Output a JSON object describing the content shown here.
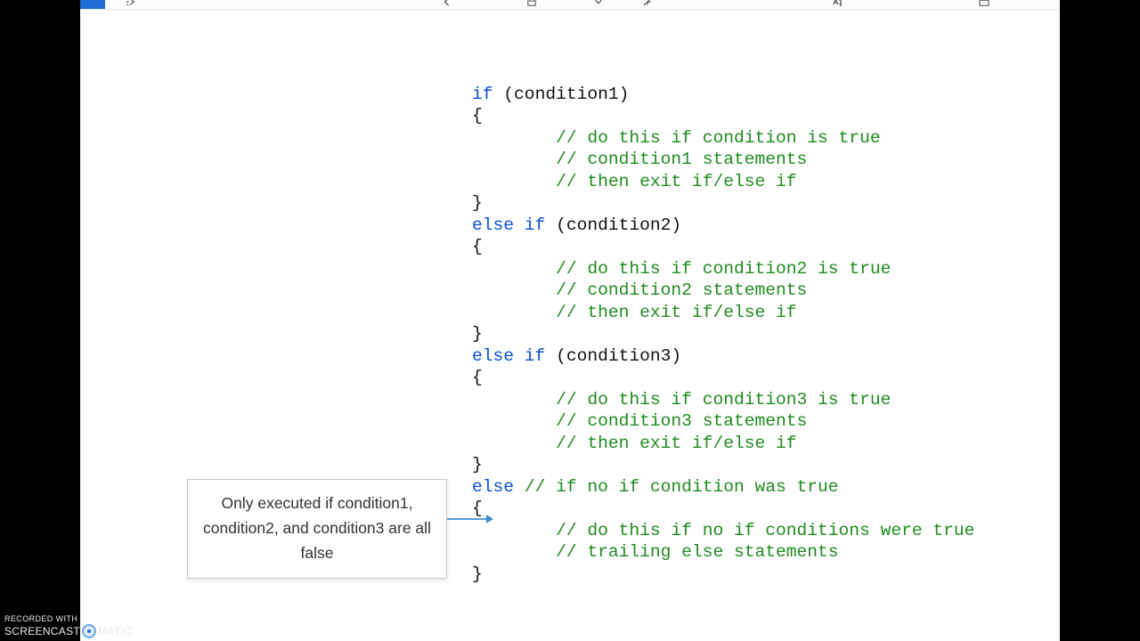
{
  "code": {
    "tokens": [
      {
        "t": "kw",
        "v": "if"
      },
      {
        "t": "tx",
        "v": " (condition1)\n{\n        "
      },
      {
        "t": "cm",
        "v": "// do this if condition is true"
      },
      {
        "t": "tx",
        "v": "\n        "
      },
      {
        "t": "cm",
        "v": "// condition1 statements"
      },
      {
        "t": "tx",
        "v": "\n        "
      },
      {
        "t": "cm",
        "v": "// then exit if/else if"
      },
      {
        "t": "tx",
        "v": "\n}\n"
      },
      {
        "t": "kw",
        "v": "else if"
      },
      {
        "t": "tx",
        "v": " (condition2)\n{\n        "
      },
      {
        "t": "cm",
        "v": "// do this if condition2 is true"
      },
      {
        "t": "tx",
        "v": "\n        "
      },
      {
        "t": "cm",
        "v": "// condition2 statements"
      },
      {
        "t": "tx",
        "v": "\n        "
      },
      {
        "t": "cm",
        "v": "// then exit if/else if"
      },
      {
        "t": "tx",
        "v": "\n}\n"
      },
      {
        "t": "kw",
        "v": "else if"
      },
      {
        "t": "tx",
        "v": " (condition3)\n{\n        "
      },
      {
        "t": "cm",
        "v": "// do this if condition3 is true"
      },
      {
        "t": "tx",
        "v": "\n        "
      },
      {
        "t": "cm",
        "v": "// condition3 statements"
      },
      {
        "t": "tx",
        "v": "\n        "
      },
      {
        "t": "cm",
        "v": "// then exit if/else if"
      },
      {
        "t": "tx",
        "v": "\n}\n"
      },
      {
        "t": "kw",
        "v": "else"
      },
      {
        "t": "tx",
        "v": " "
      },
      {
        "t": "cm",
        "v": "// if no if condition was true"
      },
      {
        "t": "tx",
        "v": "\n{\n        "
      },
      {
        "t": "cm",
        "v": "// do this if no if conditions were true"
      },
      {
        "t": "tx",
        "v": "\n        "
      },
      {
        "t": "cm",
        "v": "// trailing else statements"
      },
      {
        "t": "tx",
        "v": "\n}"
      }
    ]
  },
  "callout": {
    "text": "Only executed if condition1, condition2, and condition3 are all false"
  },
  "watermark": {
    "line1": "RECORDED WITH",
    "brand_left": "SCREENCAST",
    "brand_right": "MATIC"
  },
  "colors": {
    "keyword": "#0a4fd4",
    "comment": "#1f8b1f",
    "arrow": "#3e8ed0"
  }
}
